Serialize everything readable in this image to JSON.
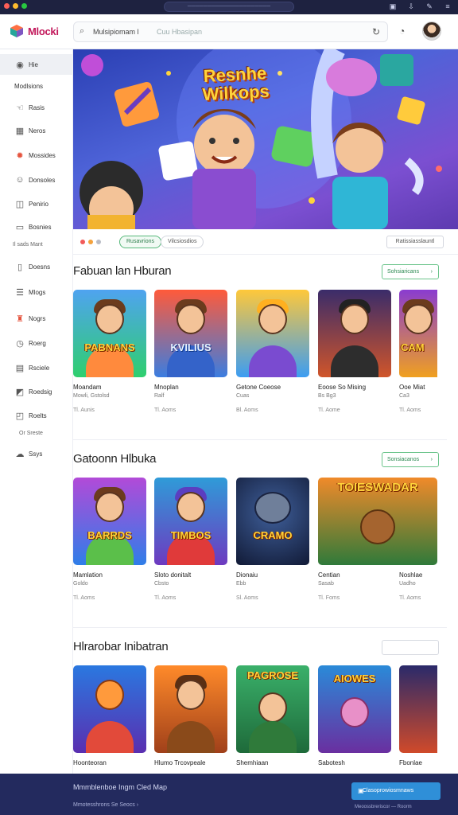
{
  "window": {
    "url": "─────────────────────",
    "dots": [
      "#ff5f57",
      "#febc2e",
      "#28c840"
    ],
    "toolbar_icons": [
      "tab-icon",
      "download-icon",
      "bookmark-icon",
      "menu-icon"
    ]
  },
  "header": {
    "logo": "Mlocki",
    "search_query": "Mulsipiomam l",
    "search_placeholder": "Cuu Hbasipan"
  },
  "sidebar": {
    "items": [
      {
        "label": "Hie",
        "icon": "home-icon"
      },
      {
        "label": "Modlsions",
        "icon": ""
      },
      {
        "label": "Rasis",
        "icon": "hand-icon"
      },
      {
        "label": "Neros",
        "icon": "grid-icon"
      },
      {
        "label": "Mossides",
        "icon": "fire-icon"
      },
      {
        "label": "Donsoles",
        "icon": "user-icon"
      },
      {
        "label": "Penirio",
        "icon": "gamepad-icon"
      },
      {
        "label": "Bosnies",
        "icon": "tv-icon"
      },
      {
        "label": "Doesns",
        "icon": "phone-icon"
      },
      {
        "label": "Mlogs",
        "icon": "list-icon"
      },
      {
        "label": "Nogrs",
        "icon": "trophy-icon"
      },
      {
        "label": "Roerg",
        "icon": "clock-icon"
      },
      {
        "label": "Rsciele",
        "icon": "calendar-icon"
      },
      {
        "label": "Roedsig",
        "icon": "chart-icon"
      },
      {
        "label": "Roelts",
        "icon": "chat-icon"
      },
      {
        "label": "Ssys",
        "icon": "cloud-icon"
      }
    ],
    "note1": "Il sads Mant",
    "note2": "Or Sreste"
  },
  "hero": {
    "title_line1": "Resnhe",
    "title_line2": "Wilkops"
  },
  "filters": {
    "dots": [
      "#f25a5a",
      "#f4a23c",
      "#b9bcc6"
    ],
    "chips": [
      "Rusavrions",
      "Vilcsiosdios"
    ],
    "right": "Ratissiasslauntl"
  },
  "sections": [
    {
      "title": "Fabuan lan Hburan",
      "button": "Sohsiaricans",
      "cards": [
        {
          "name": "Moandam",
          "sub": "Mowli, Gstolsd",
          "meta": "Tl. Aunis",
          "badge": "PABNANS"
        },
        {
          "name": "Mnoplan",
          "sub": "Ralf",
          "meta": "Tl. Aoms",
          "badge": "KVILIUS"
        },
        {
          "name": "Getone Coeose",
          "sub": "Cuas",
          "meta": "Bl. Aoms",
          "badge": ""
        },
        {
          "name": "Eoose So Mising",
          "sub": "Bs Bg3",
          "meta": "Tl. Aome",
          "badge": ""
        },
        {
          "name": "Ooe Miat",
          "sub": "Ca3",
          "meta": "Tl. Aoms",
          "badge": "CAM"
        }
      ]
    },
    {
      "title": "Gatoonn Hlbuka",
      "button": "Sonsiacanos",
      "cards": [
        {
          "name": "Mamlation",
          "sub": "Goldo",
          "meta": "Tl. Aoms",
          "badge": "BARRDS"
        },
        {
          "name": "Sloto donitalt",
          "sub": "Cbsto",
          "meta": "Tl. Aoms",
          "badge": "TIMBOS"
        },
        {
          "name": "Dionaiu",
          "sub": "Ebb",
          "meta": "Sl. Aoms",
          "badge": "CRAMO"
        },
        {
          "name": "Centian",
          "sub": "Sasab",
          "meta": "Tl. Foms",
          "badge": "TOIESWADAR"
        },
        {
          "name": "Noshlae",
          "sub": "Uadho",
          "meta": "Tl. Aoms",
          "badge": ""
        }
      ]
    },
    {
      "title": "Hlrarobar Inibatran",
      "button": "",
      "cards": [
        {
          "name": "Hoonteoran",
          "sub": "",
          "meta": "",
          "badge": ""
        },
        {
          "name": "Hlumo Trcovpeale",
          "sub": "",
          "meta": "",
          "badge": ""
        },
        {
          "name": "Shemhiaan",
          "sub": "",
          "meta": "",
          "badge": "PAGROSE"
        },
        {
          "name": "Sabotesh",
          "sub": "",
          "meta": "",
          "badge": "AIOWES"
        },
        {
          "name": "Fbonlae",
          "sub": "",
          "meta": "",
          "badge": ""
        }
      ]
    }
  ],
  "footer": {
    "text": "Mmmblenboe Ingm Cled Map",
    "links": "Mmotesshrons  Se Seocs  ›",
    "button": "Clasoprowiosmnaws",
    "small": "Meoossbreriscor — Roorm"
  }
}
